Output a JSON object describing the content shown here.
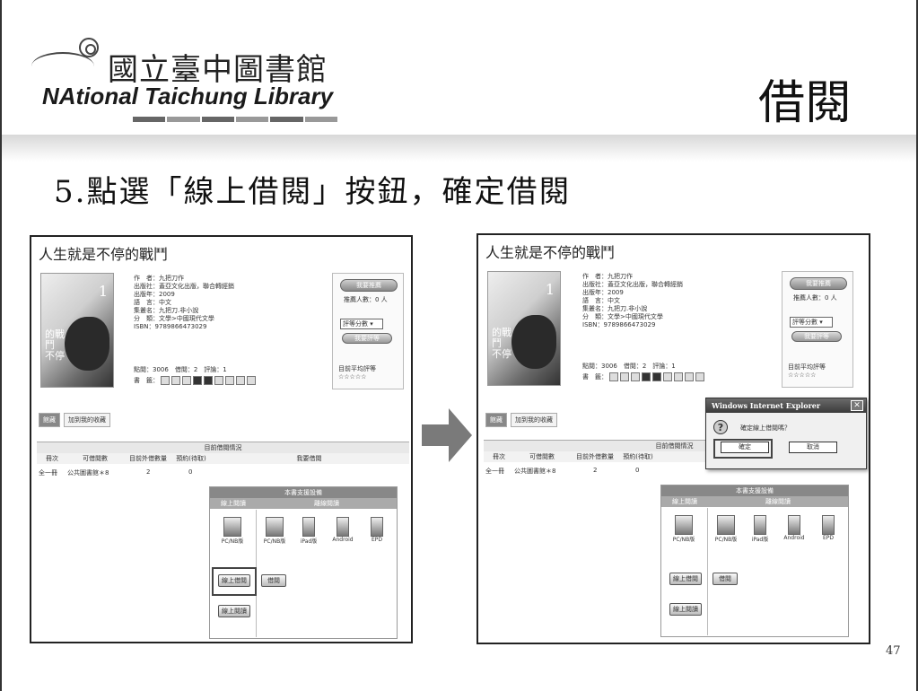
{
  "slide": {
    "library_name_zh": "國立臺中圖書館",
    "library_name_en": "NAtional Taichung Library",
    "section_title": "借閱",
    "step_text": "5.點選「線上借閱」按鈕，確定借閱",
    "page_number": "47"
  },
  "book": {
    "title": "人生就是不停的戰鬥",
    "cover_text": "的戰鬥\n不停",
    "meta": [
      "作　者：九把刀作",
      "出版社：蓋亞文化出版，聯合轉經銷",
      "出版年：2009",
      "語　言：中文",
      "集叢名：九把刀.非小說",
      "分　類：文學>中國現代文學",
      "ISBN：9789866473029"
    ],
    "stats": "點閱：3006　借閱：2　評論：1",
    "tools_label": "書　籤：",
    "side": {
      "recommend_btn": "我要推薦",
      "recommend_count": "推薦人數：0 人",
      "rating_select": "評等分數",
      "rating_btn": "我要評等",
      "avg_label": "目前平均評等",
      "stars": "☆☆☆☆☆"
    },
    "tabs": [
      "館藏",
      "加到我的收藏"
    ],
    "table": {
      "title": "目前借閱情況",
      "columns": [
        "冊次",
        "可借閱數",
        "目前外借數量",
        "預約(待取)",
        "我要借閱"
      ],
      "row": [
        "全一冊",
        "公共圖書館＊8",
        "2",
        "0"
      ]
    },
    "support": {
      "title": "本書支援設備",
      "online": "線上閱讀",
      "offline": "離線閱讀",
      "devices": [
        "PC/NB版",
        "PC/NB版",
        "iPad版",
        "Android",
        "EPD"
      ],
      "borrow_online": "線上借閱",
      "borrow": "借閱",
      "read_online": "線上閱讀"
    }
  },
  "dialog": {
    "title": "Windows Internet Explorer",
    "message": "確定線上借閱嗎？",
    "ok": "確定",
    "cancel": "取消"
  }
}
